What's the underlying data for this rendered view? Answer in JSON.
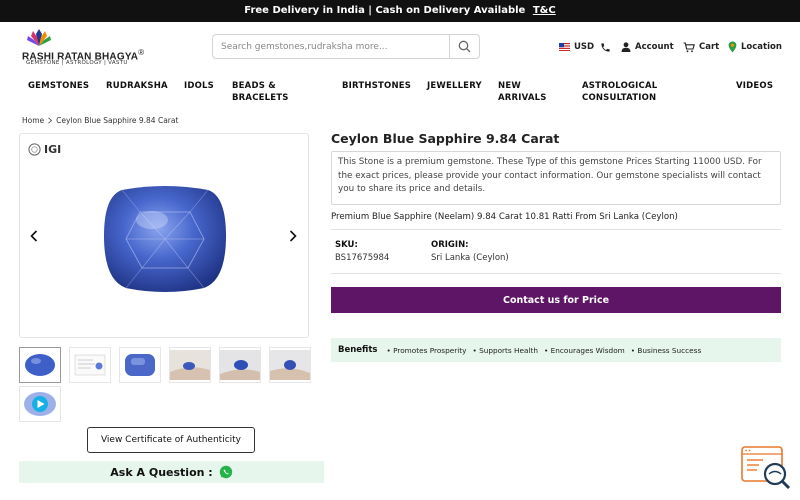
{
  "announcement": {
    "text": "Free Delivery in India | Cash on Delivery Available",
    "link": "T&C"
  },
  "brand": {
    "name": "RASHI RATAN BHAGYA",
    "registered": "®",
    "tagline": "GEMSTONE | ASTROLOGY | VASTU"
  },
  "search": {
    "placeholder": "Search gemstones,rudraksha more..."
  },
  "header_actions": {
    "currency": "USD",
    "account": "Account",
    "cart": "Cart",
    "location": "Location"
  },
  "nav": {
    "items": [
      {
        "label": "GEMSTONES"
      },
      {
        "label": "RUDRAKSHA"
      },
      {
        "label": "IDOLS"
      },
      {
        "label": "BEADS & BRACELETS"
      },
      {
        "label": "BIRTHSTONES"
      },
      {
        "label": "JEWELLERY"
      },
      {
        "label": "NEW ARRIVALS"
      },
      {
        "label": "ASTROLOGICAL CONSULTATION"
      },
      {
        "label": "VIDEOS"
      }
    ]
  },
  "breadcrumb": {
    "home": "Home",
    "current": "Ceylon Blue Sapphire 9.84 Carat"
  },
  "gallery": {
    "badge": "IGI"
  },
  "product": {
    "title": "Ceylon Blue Sapphire 9.84 Carat",
    "description": "This Stone is a premium gemstone. These Type of this gemstone Prices Starting 11000 USD. For the exact prices, please provide your contact information. Our gemstone specialists will contact you to share its price and details.",
    "subtitle": "Premium Blue Sapphire (Neelam) 9.84 Carat 10.81 Ratti From Sri Lanka (Ceylon)",
    "sku_label": "SKU:",
    "sku": "BS17675984",
    "origin_label": "ORIGIN:",
    "origin": "Sri Lanka (Ceylon)",
    "contact_button": "Contact us for Price",
    "benefits_heading": "Benefits",
    "benefits": [
      "Promotes Prosperity",
      "Supports Health",
      "Encourages Wisdom",
      "Business Success"
    ]
  },
  "buttons": {
    "certificate": "View Certificate of Authenticity",
    "ask": "Ask A Question :"
  },
  "colors": {
    "accent": "#5f1566",
    "benefit_bg": "#e6f6ec",
    "topbar": "#111111",
    "gem": "#3c5bc4"
  }
}
